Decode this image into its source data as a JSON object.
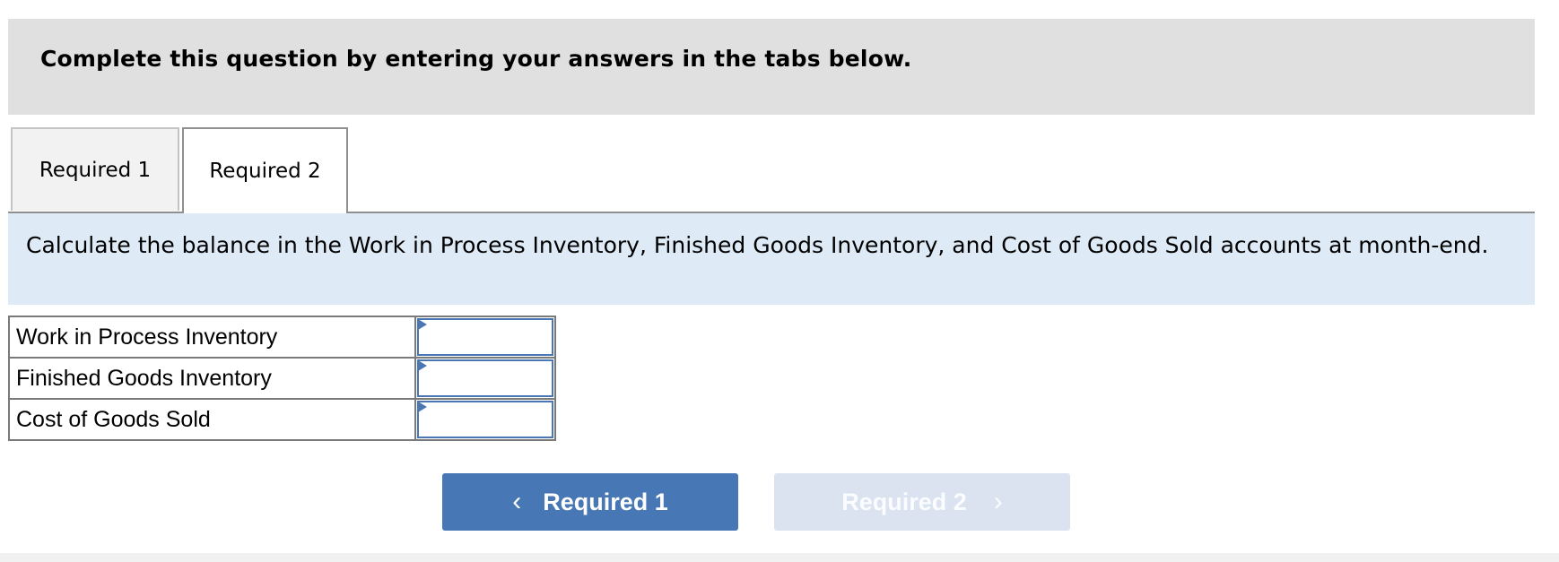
{
  "header": {
    "title": "Complete this question by entering your answers in the tabs below."
  },
  "tabs": [
    {
      "label": "Required 1",
      "active": false
    },
    {
      "label": "Required 2",
      "active": true
    }
  ],
  "instruction": "Calculate the balance in the Work in Process Inventory, Finished Goods Inventory, and Cost of Goods Sold accounts at month-end.",
  "answer_table": {
    "rows": [
      {
        "label": "Work in Process Inventory",
        "value": ""
      },
      {
        "label": "Finished Goods Inventory",
        "value": ""
      },
      {
        "label": "Cost of Goods Sold",
        "value": ""
      }
    ]
  },
  "navigation": {
    "prev": {
      "label": "Required 1",
      "icon": "chevron-left-icon",
      "glyph": "‹",
      "enabled": true
    },
    "next": {
      "label": "Required 2",
      "icon": "chevron-right-icon",
      "glyph": "›",
      "enabled": false
    }
  },
  "colors": {
    "accent": "#4777b4",
    "accent_disabled": "#dae3ef",
    "instruction_bg": "#deebf7",
    "header_bg": "#e0e0e0"
  }
}
